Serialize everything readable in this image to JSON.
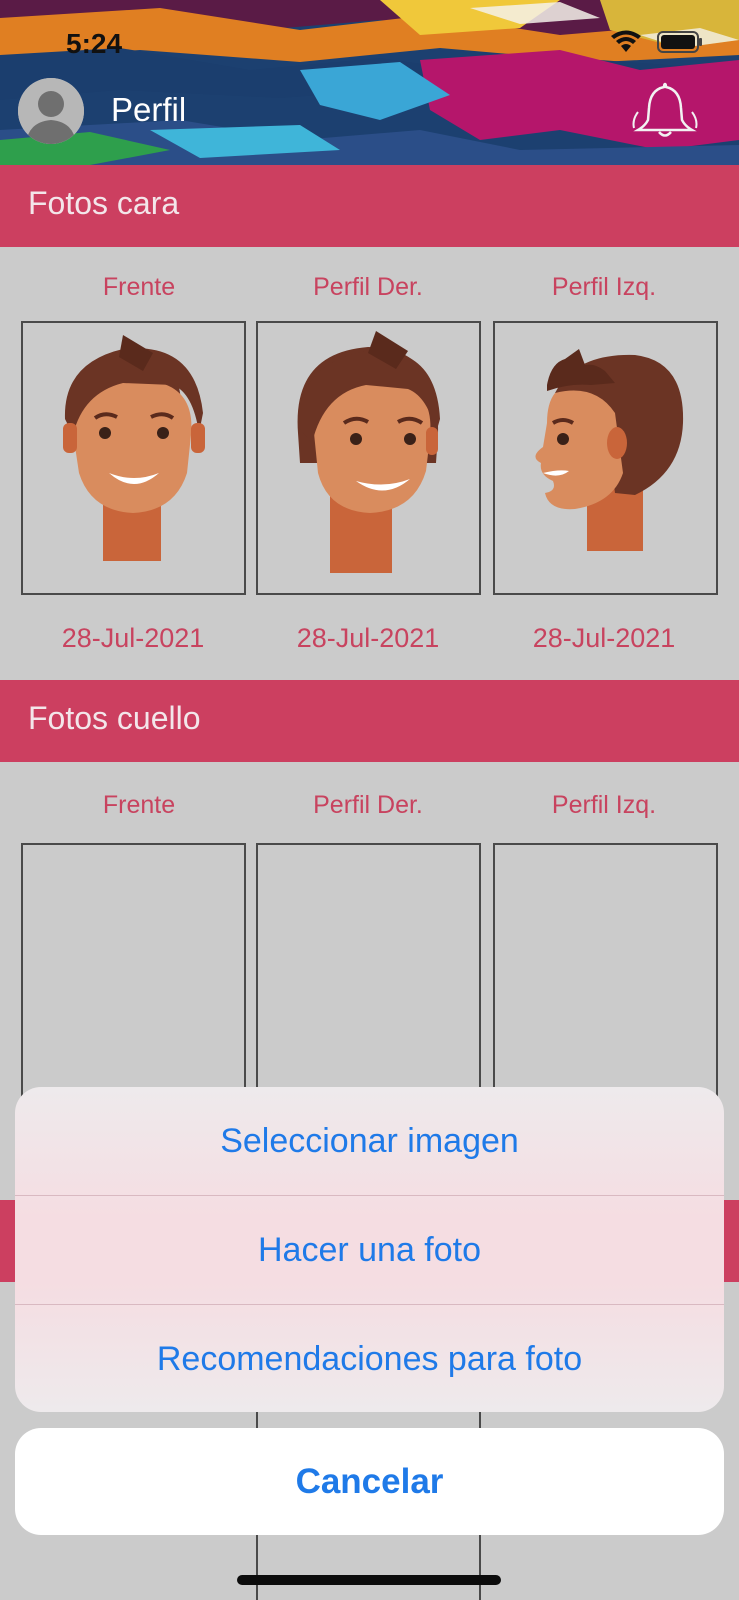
{
  "status": {
    "time": "5:24"
  },
  "header": {
    "title": "Perfil"
  },
  "sections": [
    {
      "title": "Fotos cara",
      "labels": [
        "Frente",
        "Perfil Der.",
        "Perfil Izq."
      ],
      "dates": [
        "28-Jul-2021",
        "28-Jul-2021",
        "28-Jul-2021"
      ]
    },
    {
      "title": "Fotos cuello",
      "labels": [
        "Frente",
        "Perfil Der.",
        "Perfil Izq."
      ]
    }
  ],
  "action_sheet": {
    "options": [
      "Seleccionar imagen",
      "Hacer una foto",
      "Recomendaciones para foto"
    ],
    "cancel": "Cancelar"
  },
  "colors": {
    "accent": "#cc3f60",
    "action_text": "#1f7ae8"
  },
  "icons": [
    "wifi-icon",
    "battery-icon",
    "avatar-icon",
    "bell-icon"
  ]
}
